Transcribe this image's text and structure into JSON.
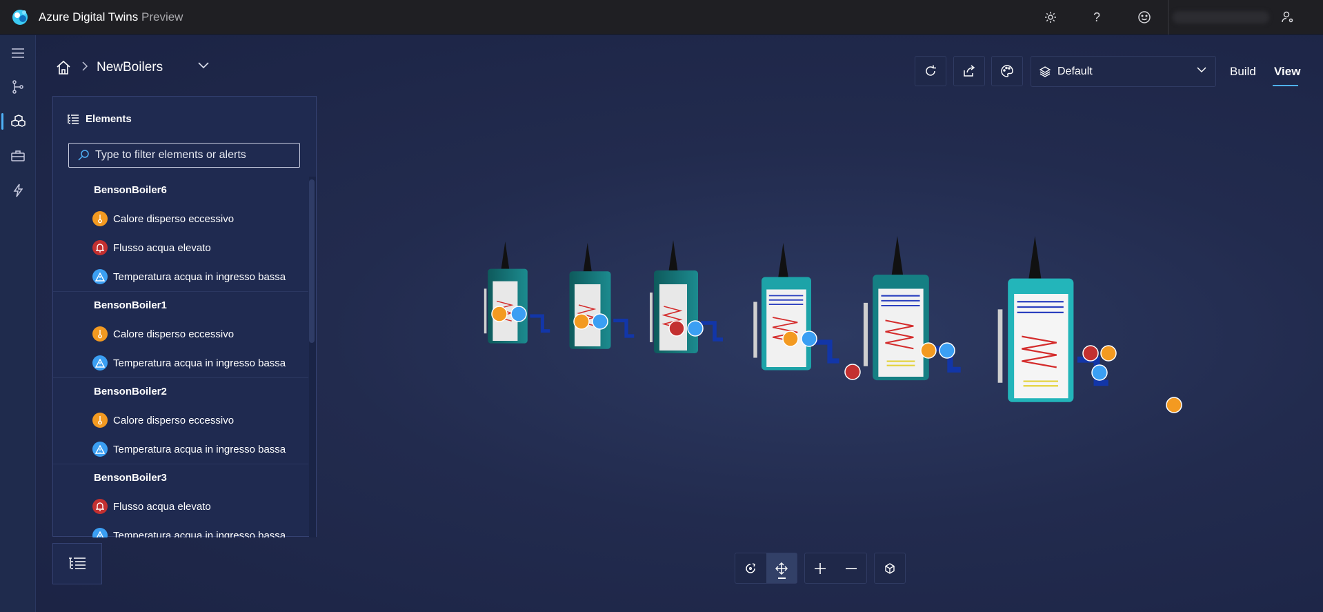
{
  "app": {
    "title": "Azure Digital Twins",
    "subtitle": "Preview"
  },
  "topbar": {
    "icons": [
      "settings-icon",
      "help-icon",
      "feedback-smiley-icon",
      "account-icon"
    ]
  },
  "rail": {
    "items": [
      "hamburger-menu-icon",
      "model-graph-icon",
      "scenes-icon",
      "toolbox-icon",
      "events-lightning-icon"
    ],
    "active_index": 2
  },
  "breadcrumb": {
    "current": "NewBoilers"
  },
  "toolbar": {
    "layer_selected": "Default",
    "modes": {
      "build": "Build",
      "view": "View"
    },
    "active_mode": "View"
  },
  "elements_panel": {
    "title": "Elements",
    "filter_placeholder": "Type to filter elements or alerts",
    "groups": [
      {
        "name": "BensonBoiler6",
        "alerts": [
          {
            "type": "orange",
            "icon": "thermometer-icon",
            "label": "Calore disperso eccessivo"
          },
          {
            "type": "red",
            "icon": "bell-icon",
            "label": "Flusso acqua elevato"
          },
          {
            "type": "blue",
            "icon": "warning-triangle-icon",
            "label": "Temperatura acqua in ingresso bassa"
          }
        ]
      },
      {
        "name": "BensonBoiler1",
        "alerts": [
          {
            "type": "orange",
            "icon": "thermometer-icon",
            "label": "Calore disperso eccessivo"
          },
          {
            "type": "blue",
            "icon": "warning-triangle-icon",
            "label": "Temperatura acqua in ingresso bassa"
          }
        ]
      },
      {
        "name": "BensonBoiler2",
        "alerts": [
          {
            "type": "orange",
            "icon": "thermometer-icon",
            "label": "Calore disperso eccessivo"
          },
          {
            "type": "blue",
            "icon": "warning-triangle-icon",
            "label": "Temperatura acqua in ingresso bassa"
          }
        ]
      },
      {
        "name": "BensonBoiler3",
        "alerts": [
          {
            "type": "red",
            "icon": "bell-icon",
            "label": "Flusso acqua elevato"
          },
          {
            "type": "blue",
            "icon": "warning-triangle-icon",
            "label": "Temperatura acqua in ingresso bassa"
          }
        ]
      }
    ]
  },
  "colors": {
    "accent": "#4fb1f7",
    "alert_orange": "#f39a21",
    "alert_red": "#c33030",
    "alert_blue": "#3b9ff3"
  }
}
